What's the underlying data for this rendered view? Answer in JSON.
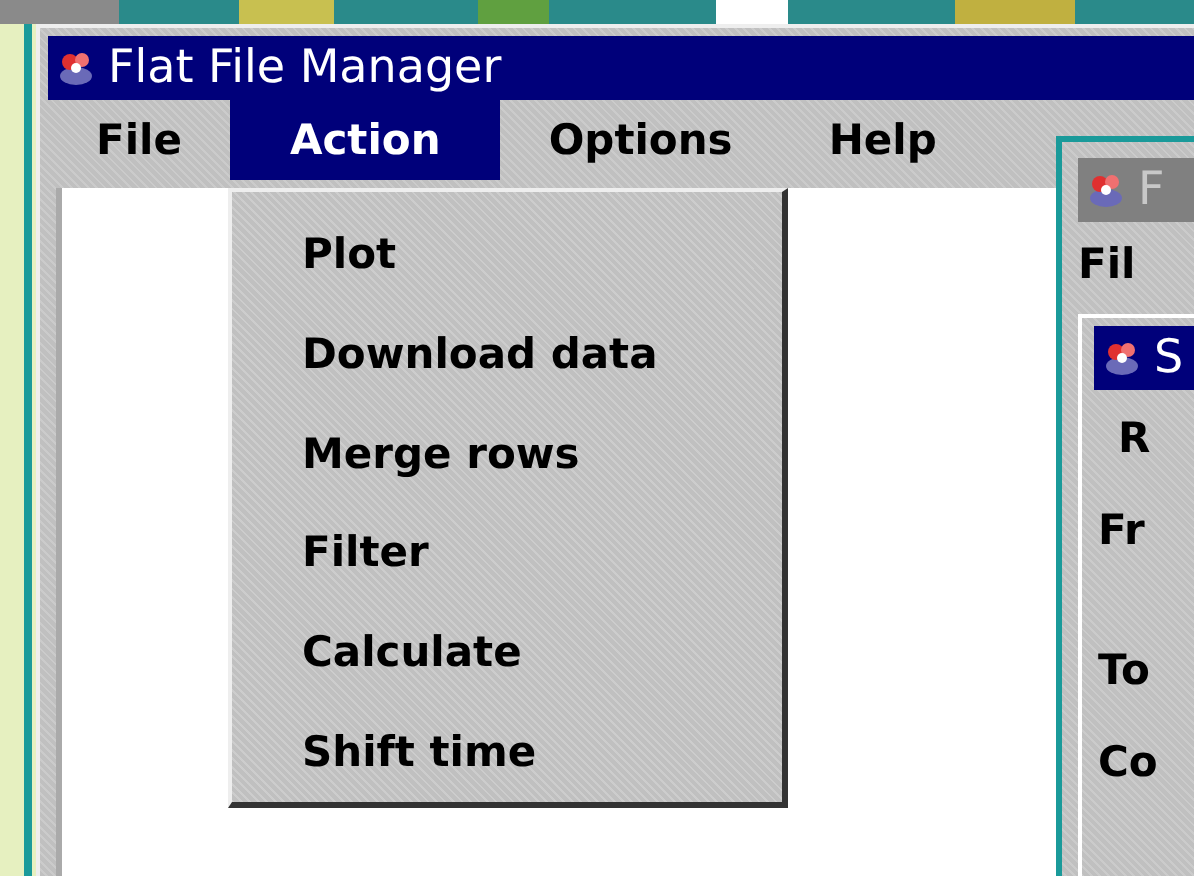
{
  "main_window": {
    "title": "Flat File Manager",
    "active": true,
    "menu_bar": [
      {
        "label": "File",
        "selected": false
      },
      {
        "label": "Action",
        "selected": true
      },
      {
        "label": "Options",
        "selected": false
      },
      {
        "label": "Help",
        "selected": false
      }
    ],
    "open_menu": {
      "items": [
        "Plot",
        "Download data",
        "Merge rows",
        "Filter",
        "Calculate",
        "Shift time"
      ]
    }
  },
  "second_window": {
    "title": "F",
    "active": false,
    "menu_bar": [
      "Fil"
    ],
    "inner_window": {
      "title": "S",
      "active": true,
      "labels": [
        "R",
        "Fr",
        "To",
        "Co"
      ]
    }
  }
}
